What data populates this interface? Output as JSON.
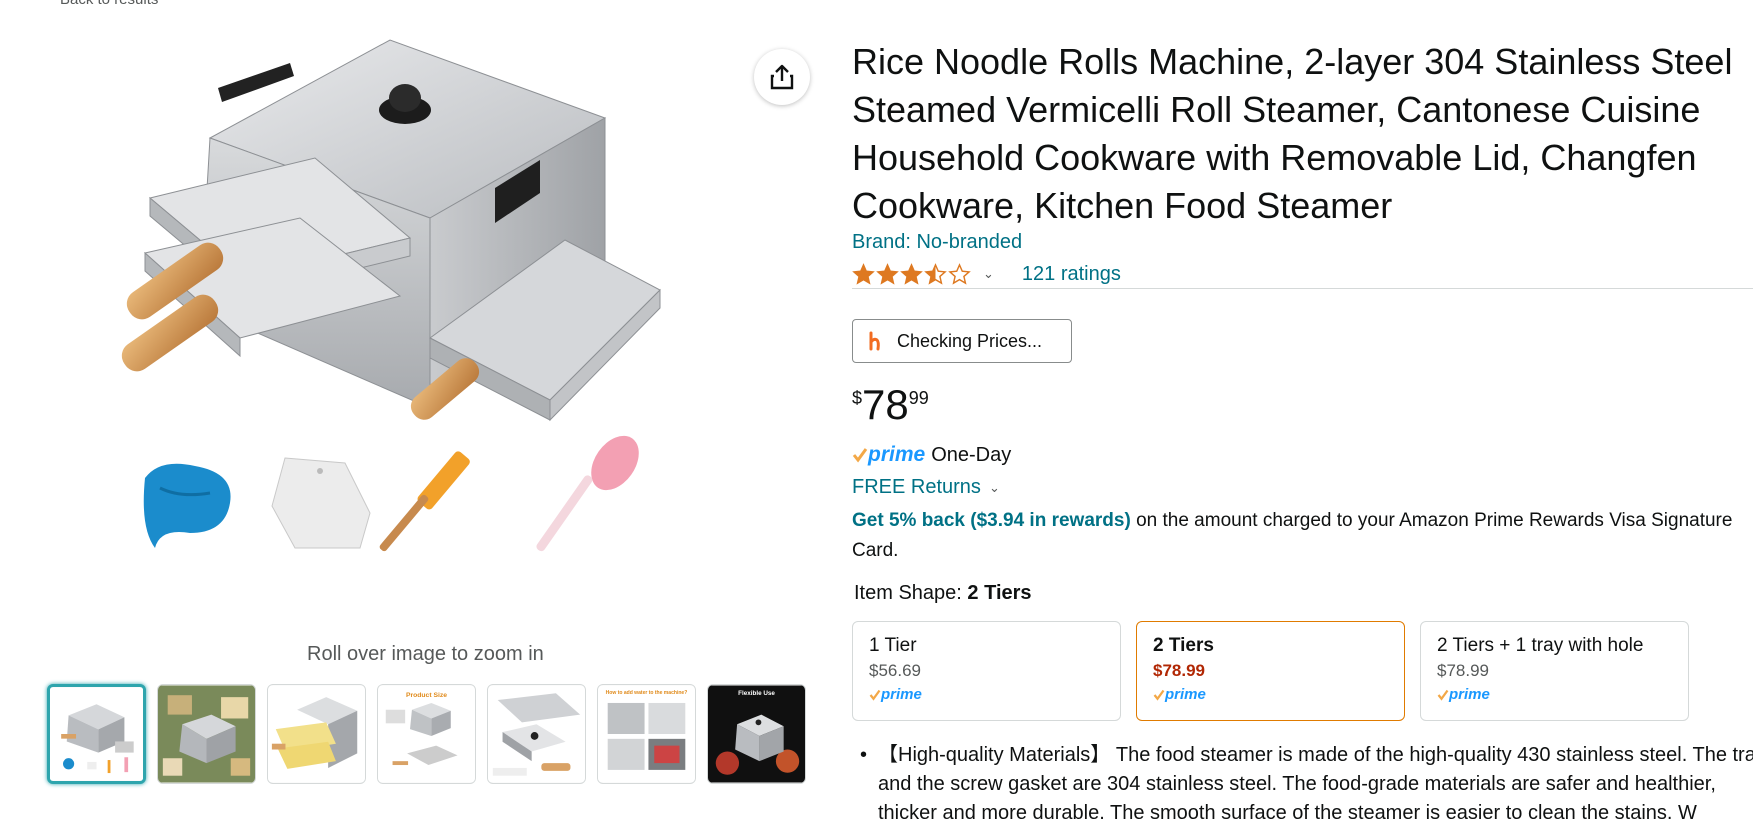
{
  "nav": {
    "back_label": "Back to results"
  },
  "gallery": {
    "zoom_hint": "Roll over image to zoom in",
    "thumbnails": [
      {
        "label": ""
      },
      {
        "label": ""
      },
      {
        "label": ""
      },
      {
        "label": "Product Size"
      },
      {
        "label": ""
      },
      {
        "label": "How to add water to the machine?"
      },
      {
        "label": "Flexible Use"
      }
    ]
  },
  "product": {
    "title": "Rice Noodle Rolls Machine, 2-layer 304 Stainless Steel Steamed Vermicelli Roll Steamer, Cantonese Cuisine Household Cookware with Removable Lid, Changfen Cookware, Kitchen Food Steamer",
    "brand": "Brand: No-branded",
    "rating_stars": 3.5,
    "ratings_count": "121 ratings",
    "checking_prices_label": "Checking Prices...",
    "price": {
      "symbol": "$",
      "whole": "78",
      "fraction": "99"
    },
    "prime_label": "prime",
    "prime_delivery": "One-Day",
    "free_returns": "FREE Returns",
    "rewards_link": "Get 5% back ($3.94 in rewards)",
    "rewards_text": " on the amount charged to your Amazon Prime Rewards Visa Signature Card.",
    "shape_label": "Item Shape:",
    "shape_value": "2 Tiers",
    "options": [
      {
        "name": "1 Tier",
        "price": "$56.69",
        "prime": "prime"
      },
      {
        "name": "2 Tiers",
        "price": "$78.99",
        "prime": "prime"
      },
      {
        "name": "2 Tiers + 1 tray with hole",
        "price": "$78.99",
        "prime": "prime"
      }
    ],
    "bullets": [
      "【High-quality Materials】 The food steamer is made of the high-quality 430 stainless steel. The tray and the screw gasket are 304 stainless steel. The food-grade materials are safer and healthier, thicker and more durable. The smooth surface of the steamer is easier to clean the stains. W"
    ]
  },
  "colors": {
    "link": "#007185",
    "prime": "#1a98ff",
    "star": "#de7921",
    "selected_border": "#e07b00",
    "price_red": "#b12704"
  },
  "icons": {
    "share": "share-icon",
    "star": "star-icon",
    "prime_check": "prime-check-icon",
    "caret": "chevron-down-icon",
    "honey": "honey-logo-icon"
  }
}
